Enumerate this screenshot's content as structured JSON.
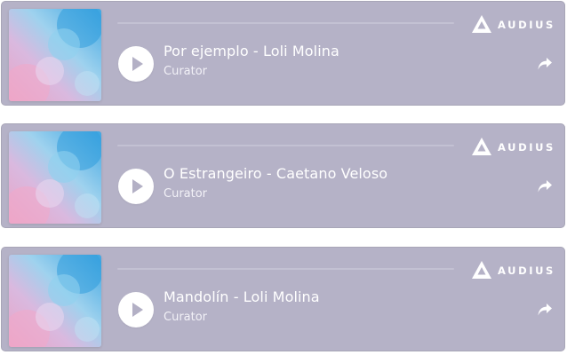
{
  "brand": {
    "name": "AUDIUS",
    "logo_icon": "audius-logo-icon"
  },
  "colors": {
    "card_background": "#b5b2c7",
    "play_button": "#ffffff",
    "play_triangle": "#b3b0c5",
    "text": "#ffffff"
  },
  "embeds": [
    {
      "title": "Por ejemplo - Loli Molina",
      "subtitle": "Curator",
      "artwork": "watercolor-pink-blue-artwork",
      "play_icon": "play-icon",
      "share_icon": "share-arrow-icon"
    },
    {
      "title": "O Estrangeiro - Caetano Veloso",
      "subtitle": "Curator",
      "artwork": "watercolor-pink-blue-artwork",
      "play_icon": "play-icon",
      "share_icon": "share-arrow-icon"
    },
    {
      "title": "Mandolín - Loli Molina",
      "subtitle": "Curator",
      "artwork": "watercolor-pink-blue-artwork",
      "play_icon": "play-icon",
      "share_icon": "share-arrow-icon"
    }
  ]
}
